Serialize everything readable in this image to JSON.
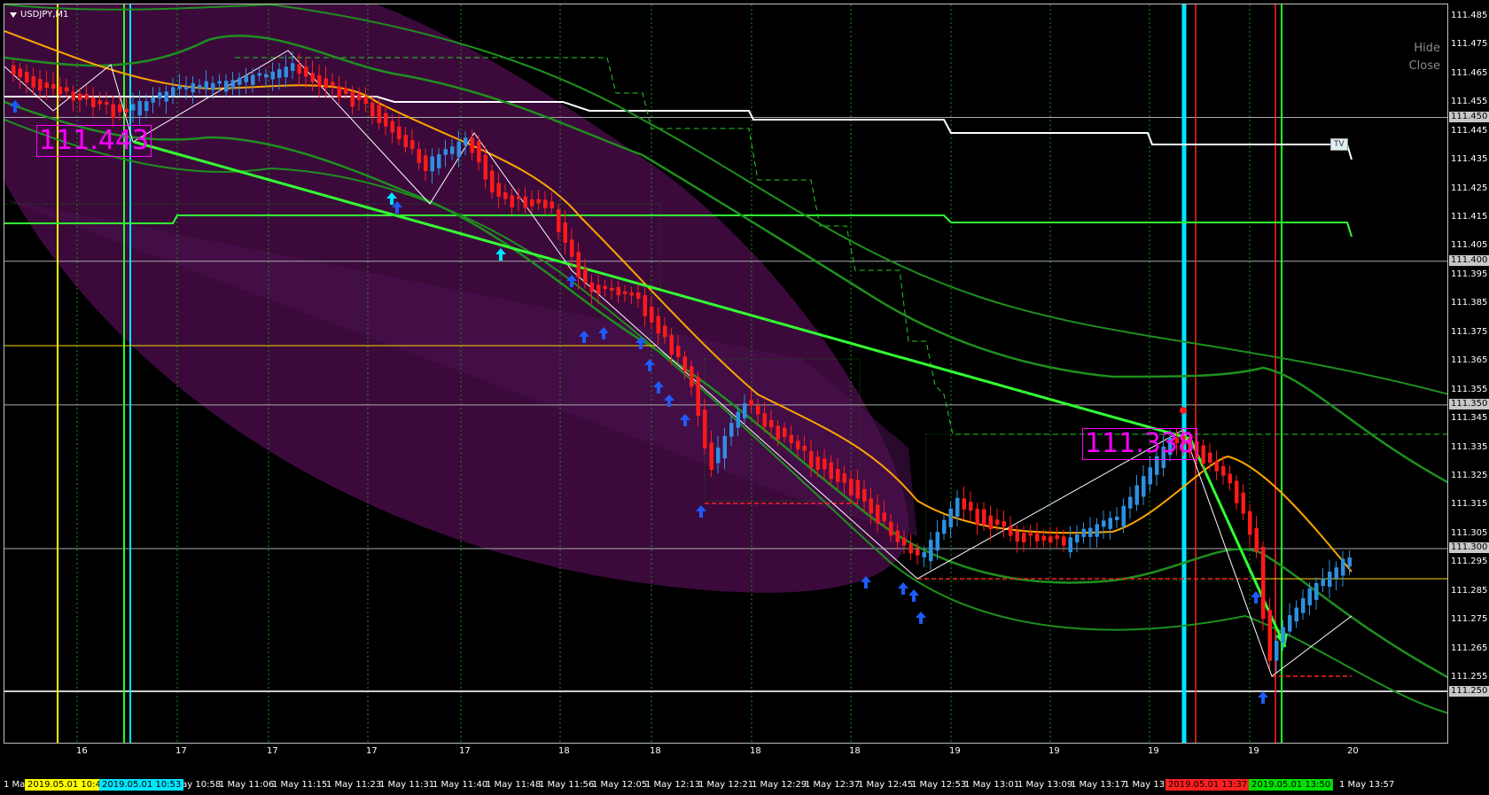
{
  "window": {
    "symbol_title": "USDJPY,M1"
  },
  "buttons": {
    "hide": "Hide",
    "close": "Close",
    "tv": "TV"
  },
  "annotations": {
    "high_price": "111.443",
    "low_price": "111.338"
  },
  "price_axis": {
    "ticks": [
      "111.485",
      "111.475",
      "111.465",
      "111.455",
      "111.445",
      "111.435",
      "111.425",
      "111.415",
      "111.405",
      "111.395",
      "111.385",
      "111.375",
      "111.365",
      "111.355",
      "111.345",
      "111.335",
      "111.325",
      "111.315",
      "111.305",
      "111.295",
      "111.285",
      "111.275",
      "111.265",
      "111.255"
    ],
    "tags": [
      "111.450",
      "111.400",
      "111.350",
      "111.300",
      "111.250"
    ]
  },
  "time_axis": {
    "hour_labels": [
      "16",
      "17",
      "17",
      "17",
      "17",
      "18",
      "18",
      "18",
      "18",
      "19",
      "19",
      "19",
      "19",
      "20"
    ],
    "labels": [
      "1 May 10:58",
      "1 May 11:06",
      "1 May 11:15",
      "1 May 11:23",
      "1 May 11:31",
      "1 May 11:40",
      "1 May 11:48",
      "1 May 11:56",
      "1 May 12:05",
      "1 May 12:13",
      "1 May 12:21",
      "1 May 12:29",
      "1 May 12:37",
      "1 May 12:45",
      "1 May 12:53",
      "1 May 13:01",
      "1 May 13:09",
      "1 May 13:17",
      "1 May 13",
      "1 May 13:57"
    ],
    "left_label": "1 May",
    "tags": [
      {
        "text": "2019.05.01 10:42",
        "color": "#ffff00"
      },
      {
        "text": "2019.05.01 10:53",
        "color": "#00e5ff"
      },
      {
        "text": "2019.05.01 13:37",
        "color": "#ff2020"
      },
      {
        "text": "2019.05.01 13:50",
        "color": "#00e000"
      }
    ]
  },
  "colors": {
    "bull": "#2e8fe0",
    "bear": "#ff1a1a",
    "cloud": "#3c0a3c",
    "trend": "#33ff33",
    "ma": "#ffa500",
    "bands": "#1f8f1f"
  }
}
